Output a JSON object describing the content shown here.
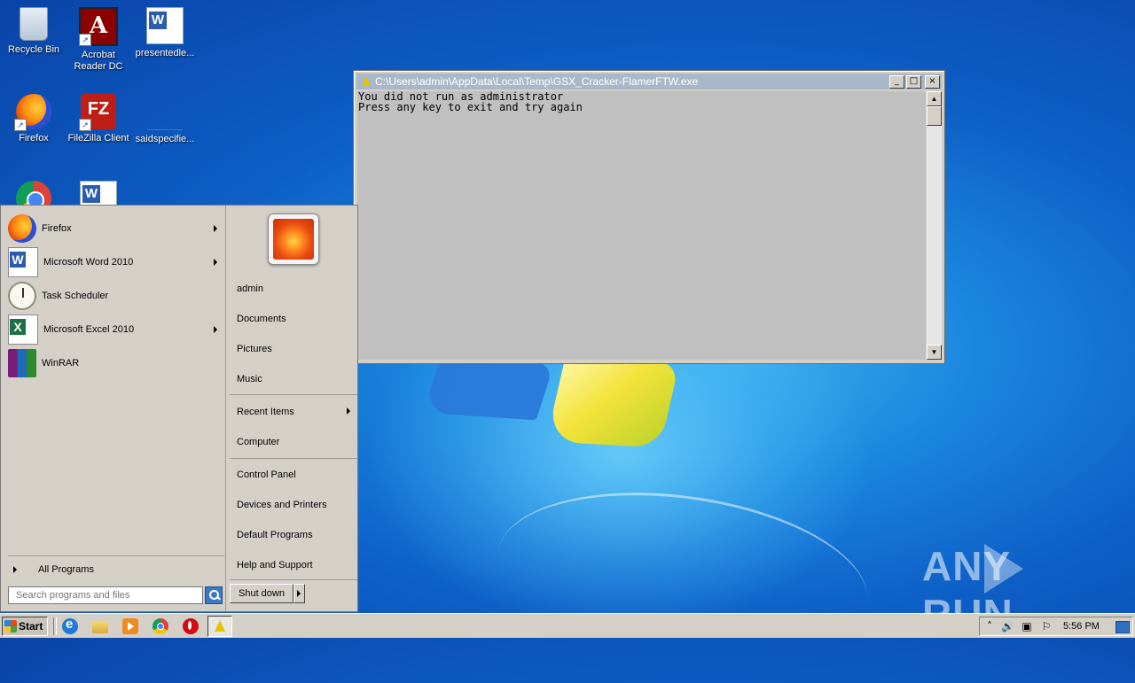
{
  "desktop": {
    "icons": [
      {
        "label": "Recycle Bin",
        "icon": "recycle-bin-icon"
      },
      {
        "label": "Acrobat Reader DC",
        "icon": "acrobat-icon"
      },
      {
        "label": "presentedle...",
        "icon": "word-document-icon"
      },
      {
        "label": "Firefox",
        "icon": "firefox-icon"
      },
      {
        "label": "FileZilla Client",
        "icon": "filezilla-icon"
      },
      {
        "label": "saidspecifie...",
        "icon": "file-icon"
      }
    ]
  },
  "console": {
    "title": "C:\\Users\\admin\\AppData\\Local\\Temp\\GSX_Cracker-FlamerFTW.exe",
    "lines": [
      "You did not run as administrator",
      "Press any key to exit and try again"
    ],
    "buttons": {
      "minimize": "_",
      "maximize": "□",
      "close": "×"
    }
  },
  "start_menu": {
    "programs": [
      {
        "label": "Firefox",
        "has_submenu": true
      },
      {
        "label": "Microsoft Word 2010",
        "has_submenu": true
      },
      {
        "label": "Task Scheduler",
        "has_submenu": false
      },
      {
        "label": "Microsoft Excel 2010",
        "has_submenu": true
      },
      {
        "label": "WinRAR",
        "has_submenu": false
      }
    ],
    "all_programs": "All Programs",
    "search_placeholder": "Search programs and files",
    "right": {
      "user": "admin",
      "documents": "Documents",
      "pictures": "Pictures",
      "music": "Music",
      "recent_items": "Recent Items",
      "computer": "Computer",
      "control_panel": "Control Panel",
      "devices_printers": "Devices and Printers",
      "default_programs": "Default Programs",
      "help_support": "Help and Support"
    },
    "shutdown": "Shut down"
  },
  "taskbar": {
    "start": "Start",
    "clock": "5:56 PM"
  },
  "watermark": {
    "text": "ANY",
    "text2": "RUN"
  }
}
